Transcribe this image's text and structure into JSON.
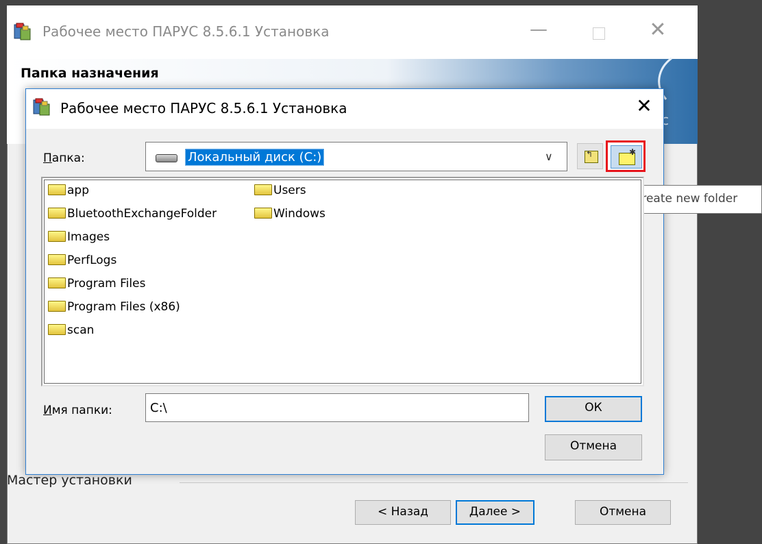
{
  "outer_window": {
    "title": "Рабочее место ПАРУС 8.5.6.1 Установка",
    "banner_title": "Папка назначения",
    "banner_logo_text": "с",
    "footer_label": "Мастер установки",
    "buttons": {
      "back": "< Назад",
      "next": "Далее >",
      "cancel": "Отмена"
    },
    "controls": {
      "minimize": "—",
      "close": "✕"
    }
  },
  "dialog": {
    "title": "Рабочее место ПАРУС 8.5.6.1 Установка",
    "close": "✕",
    "folder_label_accel": "П",
    "folder_label_rest": "апка:",
    "drive_selected": "Локальный диск (C:)",
    "drive_arrow": "∨",
    "tooltip": "create new folder",
    "folders_col1": [
      "app",
      "BluetoothExchangeFolder",
      "Images",
      "PerfLogs",
      "Program Files",
      "Program Files (x86)",
      "scan"
    ],
    "folders_col2": [
      "Users",
      "Windows"
    ],
    "name_label_accel": "И",
    "name_label_rest": "мя папки:",
    "name_value": "C:\\",
    "ok": "ОК",
    "cancel": "Отмена"
  },
  "icons": [
    "installer-app-icon",
    "drive-icon",
    "up-folder-icon",
    "new-folder-icon",
    "folder-icon"
  ],
  "colors": {
    "selection": "#0078d7",
    "highlight_border": "#e8141b",
    "dialog_border": "#2f7fd1"
  }
}
